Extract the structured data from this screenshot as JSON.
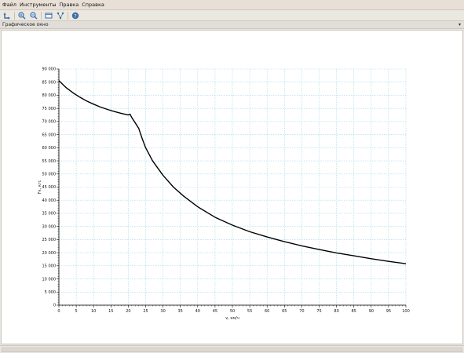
{
  "menu": {
    "file": "Файл",
    "tools": "Инструменты",
    "edit": "Правка",
    "help": "Справка"
  },
  "toolbar": {
    "icons": [
      "rotate-icon",
      "zoom-in-icon",
      "zoom-out-icon",
      "window-icon",
      "data-tips-icon",
      "help-icon"
    ]
  },
  "panel": {
    "title": "Графическое окно",
    "menu_glyph": "▾"
  },
  "colors": {
    "curve": "#000000",
    "grid": "#9fd8e8",
    "axes": "#000000",
    "background": "#ffffff"
  },
  "chart_data": {
    "type": "line",
    "title": "",
    "xlabel": "v, км/ч",
    "ylabel": "Fк, кгс",
    "xlim": [
      0,
      100
    ],
    "ylim": [
      0,
      90000
    ],
    "grid": true,
    "x_ticks": [
      "0",
      "5",
      "10",
      "15",
      "20",
      "25",
      "30",
      "35",
      "40",
      "45",
      "50",
      "55",
      "60",
      "65",
      "70",
      "75",
      "80",
      "85",
      "90",
      "95",
      "100"
    ],
    "y_ticks": [
      "0",
      "5 000",
      "10 000",
      "15 000",
      "20 000",
      "25 000",
      "30 000",
      "35 000",
      "40 000",
      "45 000",
      "50 000",
      "55 000",
      "60 000",
      "65 000",
      "70 000",
      "75 000",
      "80 000",
      "85 000",
      "90 000"
    ],
    "series": [
      {
        "name": "",
        "x": [
          0,
          2,
          4,
          6,
          8,
          10,
          12,
          14,
          16,
          18,
          20,
          20.5,
          21,
          22,
          23,
          24,
          25,
          27,
          30,
          33,
          36,
          40,
          45,
          50,
          55,
          60,
          65,
          70,
          75,
          80,
          85,
          90,
          95,
          100
        ],
        "y": [
          85600,
          83000,
          81000,
          79300,
          77800,
          76600,
          75500,
          74600,
          73800,
          73100,
          72500,
          72800,
          71500,
          69500,
          67400,
          63500,
          60000,
          55000,
          49500,
          45000,
          41500,
          37500,
          33500,
          30500,
          28000,
          26000,
          24200,
          22600,
          21200,
          19900,
          18800,
          17700,
          16700,
          15800
        ]
      }
    ]
  }
}
